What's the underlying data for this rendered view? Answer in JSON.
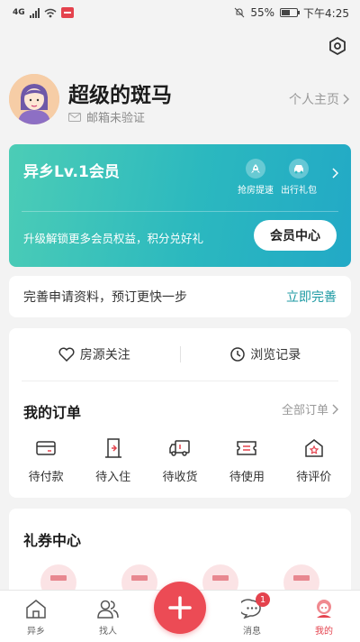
{
  "status_bar": {
    "network": "4G",
    "battery": "55%",
    "time": "下午4:25"
  },
  "profile": {
    "nickname": "超级的斑马",
    "email_status": "邮箱未验证",
    "homepage_link": "个人主页"
  },
  "vip": {
    "title": "异乡Lv.1会员",
    "perks": [
      {
        "label": "抢房提速",
        "icon": "rocket-icon"
      },
      {
        "label": "出行礼包",
        "icon": "car-icon"
      }
    ],
    "desc": "升级解锁更多会员权益，积分兑好礼",
    "center_button": "会员中心",
    "gradient_start": "#4ccdb6",
    "gradient_end": "#22a9c6"
  },
  "info_banner": {
    "text": "完善申请资料，预订更快一步",
    "action": "立即完善"
  },
  "quick_links": [
    {
      "label": "房源关注",
      "icon": "heart-icon"
    },
    {
      "label": "浏览记录",
      "icon": "clock-icon"
    }
  ],
  "orders": {
    "title": "我的订单",
    "all_link": "全部订单",
    "items": [
      {
        "label": "待付款",
        "icon": "wallet-icon"
      },
      {
        "label": "待入住",
        "icon": "door-icon"
      },
      {
        "label": "待收货",
        "icon": "truck-icon"
      },
      {
        "label": "待使用",
        "icon": "ticket-icon"
      },
      {
        "label": "待评价",
        "icon": "star-house-icon"
      }
    ]
  },
  "coupons": {
    "title": "礼券中心"
  },
  "tabbar": {
    "tabs": [
      {
        "label": "异乡",
        "icon": "home-icon"
      },
      {
        "label": "找人",
        "icon": "people-icon"
      },
      {
        "label": "",
        "icon": "plus-icon"
      },
      {
        "label": "消息",
        "icon": "message-icon",
        "badge": "1"
      },
      {
        "label": "我的",
        "icon": "profile-icon",
        "active": true
      }
    ]
  },
  "colors": {
    "accent": "#e4424d",
    "teal": "#1d9aa3"
  }
}
